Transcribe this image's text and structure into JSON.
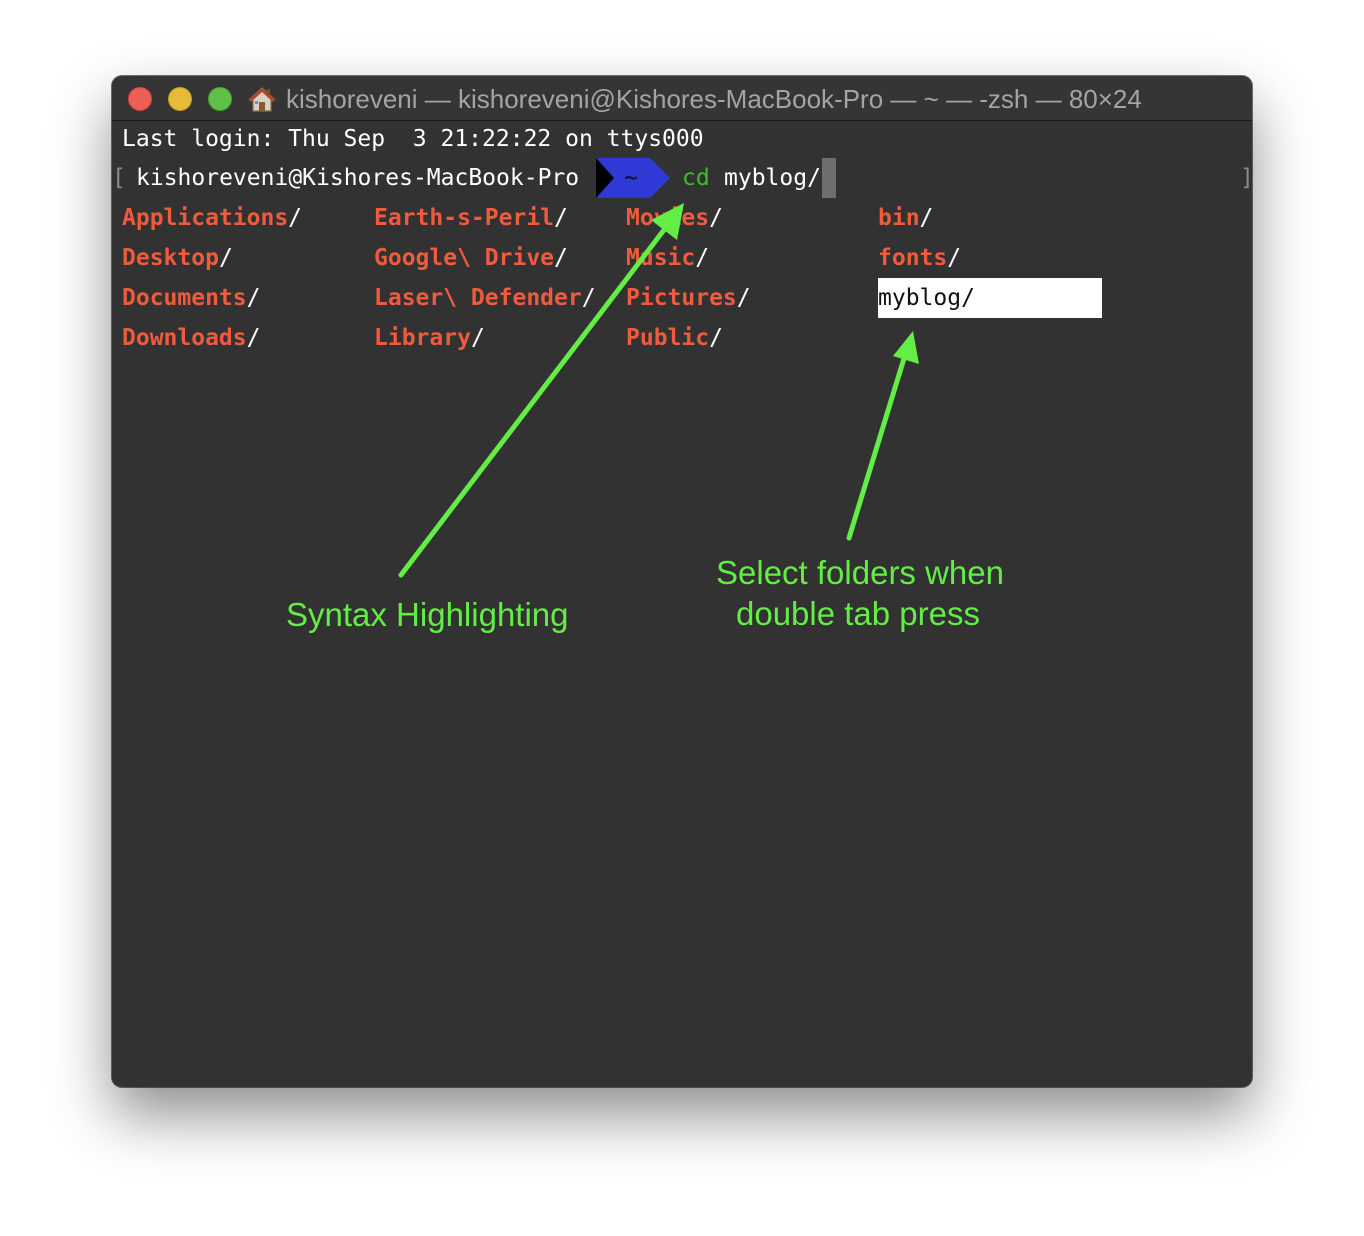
{
  "window": {
    "title": "kishoreveni — kishoreveni@Kishores-MacBook-Pro — ~ — -zsh — 80×24"
  },
  "terminal": {
    "last_login": "Last login: Thu Sep  3 21:22:22 on ttys000",
    "prompt_user_host": "kishoreveni@Kishores-MacBook-Pro",
    "prompt_dir": "~",
    "command_name": "cd",
    "command_arg": "myblog/",
    "bracket_open": "[",
    "bracket_close": "]",
    "completions": [
      [
        "Applications",
        "Earth-s-Peril",
        "Movies",
        "bin"
      ],
      [
        "Desktop",
        "Google\\ Drive",
        "Music",
        "fonts"
      ],
      [
        "Documents",
        "Laser\\ Defender",
        "Pictures",
        "myblog"
      ],
      [
        "Downloads",
        "Library",
        "Public",
        ""
      ]
    ],
    "completion_suffix": "/",
    "selected_completion": "myblog"
  },
  "annotations": {
    "syntax": "Syntax Highlighting",
    "select_line1": "Select folders when",
    "select_line2": "double tab press"
  },
  "colors": {
    "directory": "#ef5b3c",
    "command": "#3fbe2c",
    "powerline_dir": "#2f3ad6",
    "annotation": "#62ee44"
  }
}
